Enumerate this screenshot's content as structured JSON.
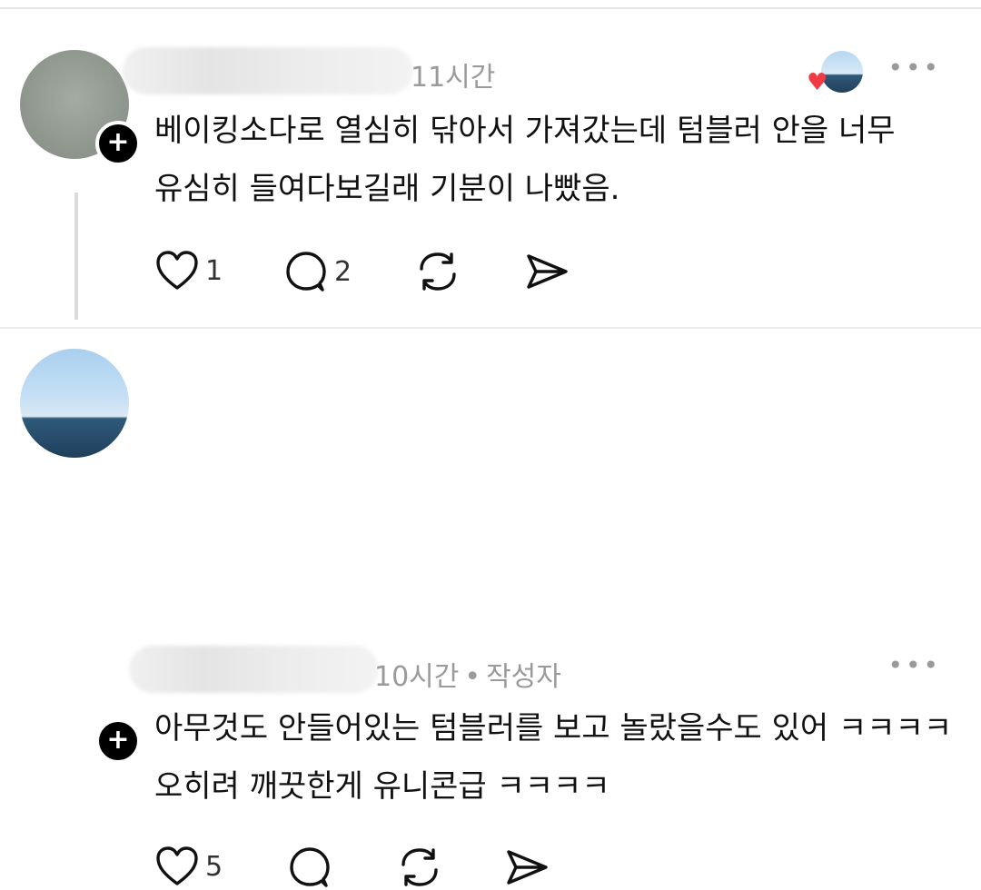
{
  "comments": [
    {
      "time": "11시간",
      "author_tag": "",
      "line1": "베이킹소다로 열심히 닦아서 가져갔는데 텀블러 안을 너무",
      "line2": "유심히 들여다보길래 기분이 나빴음.",
      "likes": "1",
      "replies": "2",
      "more": "•••"
    },
    {
      "time": "10시간",
      "author_tag": "작성자",
      "line1": "아무것도 안들어있는 텀블러를 보고 놀랐을수도 있어 ㅋㅋㅋㅋ",
      "line2": "오히려 깨끗한게 유니콘급 ㅋㅋㅋㅋ",
      "likes": "5",
      "replies": "",
      "more": "•••"
    }
  ],
  "icons": {
    "plus": "+",
    "heart_badge": "♥",
    "separator": "•"
  }
}
